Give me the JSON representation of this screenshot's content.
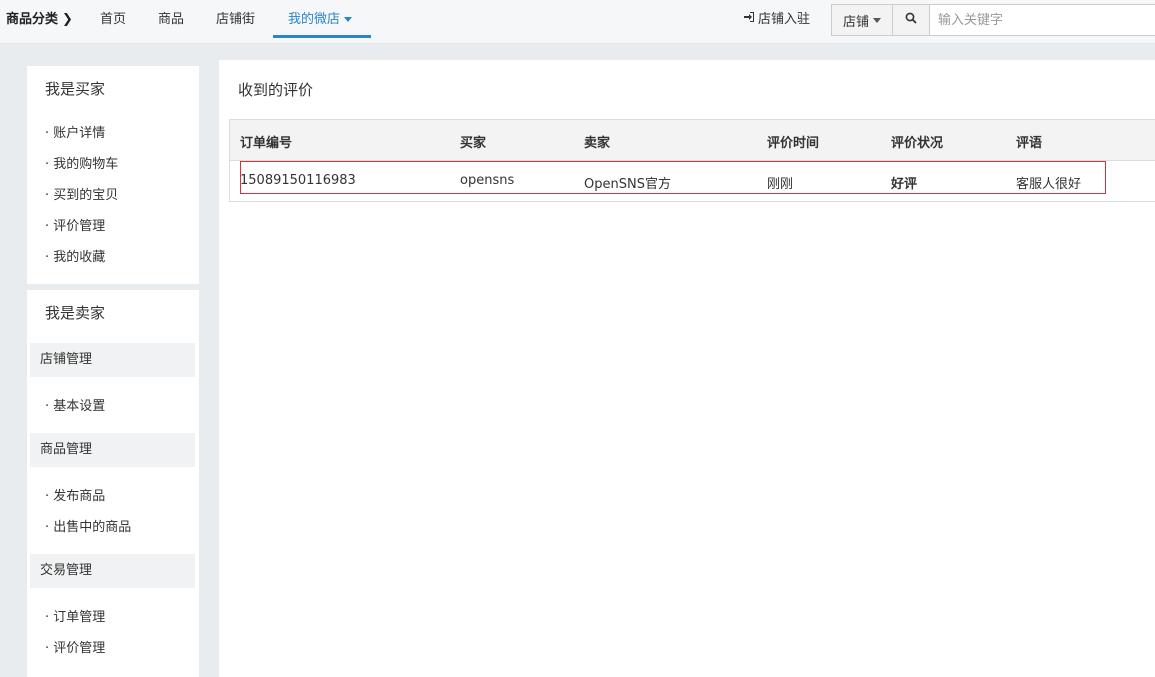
{
  "topnav": {
    "category": "商品分类",
    "items": [
      "首页",
      "商品",
      "店铺街",
      "我的微店"
    ],
    "active": "我的微店",
    "store_join": "店铺入驻",
    "search_scope": "店铺",
    "search_placeholder": "输入关键字"
  },
  "sidebar": {
    "buyer_title": "我是买家",
    "buyer_links": [
      "账户详情",
      "我的购物车",
      "买到的宝贝",
      "评价管理",
      "我的收藏"
    ],
    "seller_title": "我是卖家",
    "groups": [
      {
        "title": "店铺管理",
        "links": [
          "基本设置"
        ]
      },
      {
        "title": "商品管理",
        "links": [
          "发布商品",
          "出售中的商品"
        ]
      },
      {
        "title": "交易管理",
        "links": [
          "订单管理",
          "评价管理"
        ]
      }
    ]
  },
  "main": {
    "title": "收到的评价",
    "columns": [
      "订单编号",
      "买家",
      "卖家",
      "评价时间",
      "评价状况",
      "评语"
    ],
    "rows": [
      [
        "15089150116983",
        "opensns",
        "OpenSNS官方",
        "刚刚",
        "好评",
        "客服人很好"
      ]
    ]
  },
  "colors": {
    "accent": "#2a86c8",
    "highlight_border": "#d9323a"
  },
  "icons": {
    "category_chevron": "chevron-right-icon",
    "store_join": "sign-in-icon",
    "search": "search-icon"
  }
}
